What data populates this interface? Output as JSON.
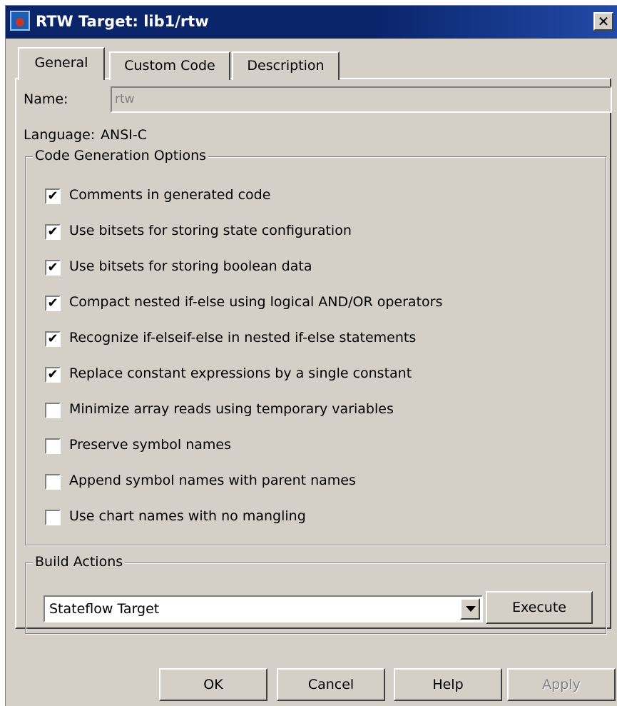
{
  "window": {
    "title": "RTW Target: lib1/rtw",
    "close_label": "✕"
  },
  "tabs": [
    {
      "label": "General",
      "active": true
    },
    {
      "label": "Custom Code",
      "active": false
    },
    {
      "label": "Description",
      "active": false
    }
  ],
  "general": {
    "name_label": "Name:",
    "name_value": "rtw",
    "language_label": "Language:",
    "language_value": "ANSI-C"
  },
  "code_generation": {
    "title": "Code Generation Options",
    "options": [
      {
        "label": "Comments in generated code",
        "checked": true
      },
      {
        "label": "Use bitsets for storing state configuration",
        "checked": true
      },
      {
        "label": "Use bitsets for storing boolean data",
        "checked": true
      },
      {
        "label": "Compact nested if-else using logical AND/OR operators",
        "checked": true
      },
      {
        "label": "Recognize if-elseif-else in nested if-else statements",
        "checked": true
      },
      {
        "label": "Replace constant expressions by a single constant",
        "checked": true
      },
      {
        "label": "Minimize array reads using temporary variables",
        "checked": false
      },
      {
        "label": "Preserve symbol names",
        "checked": false
      },
      {
        "label": "Append symbol names with parent names",
        "checked": false
      },
      {
        "label": "Use chart names with no mangling",
        "checked": false
      }
    ]
  },
  "build_actions": {
    "title": "Build Actions",
    "selected": "Stateflow Target",
    "execute_label": "Execute"
  },
  "footer": {
    "ok_label": "OK",
    "cancel_label": "Cancel",
    "help_label": "Help",
    "apply_label": "Apply"
  },
  "checkmark": "✔"
}
